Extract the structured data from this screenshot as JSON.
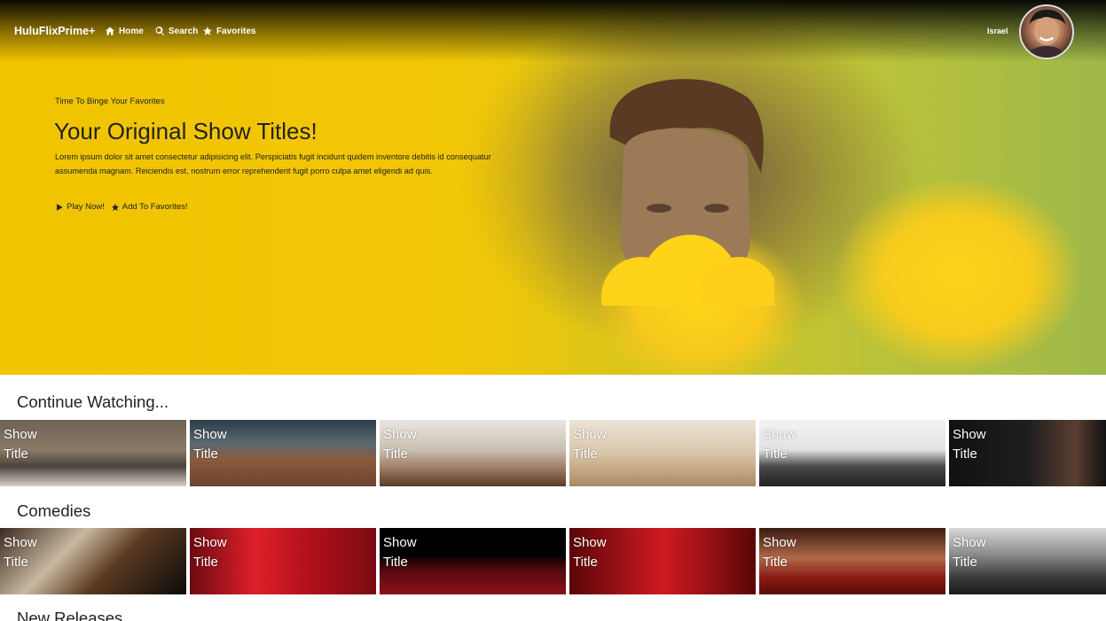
{
  "nav": {
    "brand": "HuluFlixPrime+",
    "items": [
      {
        "label": "Home",
        "icon": "home-icon"
      },
      {
        "label": "Search",
        "icon": "search-icon"
      },
      {
        "label": "Favorites",
        "icon": "star-icon"
      }
    ],
    "username": "Israel"
  },
  "hero": {
    "eyebrow": "Time To Binge Your Favorites",
    "title": "Your Original Show Titles!",
    "description": "Lorem ipsum dolor sit amet consectetur adipisicing elit. Perspiciatis fugit incidunt quidem inventore debitis id consequatur assumenda magnam. Reiciendis est, nostrum error reprehenderit fugit porro culpa amet eligendi ad quis.",
    "play_label": "Play Now!",
    "favorite_label": "Add To Favorites!"
  },
  "sections": [
    {
      "title": "Continue Watching...",
      "tiles": [
        {
          "line1": "Show",
          "line2": "Title",
          "bg": "linear-gradient(180deg,#6e6257 0%,#8a7a66 45%,#4a433c 70%,#d6d0c8 100%)"
        },
        {
          "line1": "Show",
          "line2": "Title",
          "bg": "linear-gradient(180deg,#2d3c46 0%,#5b6a70 35%,#8a5a3c 60%,#6b4430 100%)"
        },
        {
          "line1": "Show",
          "line2": "Title",
          "bg": "linear-gradient(180deg,#e9e6e0 0%,#c9bfb2 45%,#a3826a 70%,#5b3a2a 100%)"
        },
        {
          "line1": "Show",
          "line2": "Title",
          "bg": "linear-gradient(180deg,#ede4d6 0%,#d9c6a9 50%,#c4a884 75%,#a88a64 100%)"
        },
        {
          "line1": "Show",
          "line2": "Title",
          "bg": "linear-gradient(180deg,#f3f3f3 0%,#e2e2e2 45%,#4a4a4a 70%,#222 100%)"
        },
        {
          "line1": "Show",
          "line2": "Title",
          "bg": "linear-gradient(90deg,#111 0%,#1e1e1e 50%,#5a3e30 80%,#111 100%)"
        }
      ]
    },
    {
      "title": "Comedies",
      "tiles": [
        {
          "line1": "Show",
          "line2": "Title",
          "bg": "linear-gradient(135deg,#3a2a20 0%,#c8b8a0 35%,#5a3a20 60%,#0a0a0a 100%)"
        },
        {
          "line1": "Show",
          "line2": "Title",
          "bg": "linear-gradient(90deg,#6b0a10 0%,#e0202a 35%,#b0101a 65%,#7a0a12 100%)"
        },
        {
          "line1": "Show",
          "line2": "Title",
          "bg": "linear-gradient(180deg,#000 0%,#000 40%,#5a0a10 65%,#8a1018 100%)"
        },
        {
          "line1": "Show",
          "line2": "Title",
          "bg": "linear-gradient(90deg,#5a0608 0%,#d01a20 50%,#5a0608 100%)"
        },
        {
          "line1": "Show",
          "line2": "Title",
          "bg": "linear-gradient(180deg,#3a1a10 0%,#b06a4a 45%,#8a1a14 75%,#5a0c0a 100%)"
        },
        {
          "line1": "Show",
          "line2": "Title",
          "bg": "linear-gradient(180deg,#d8d8d8 0%,#8a8a8a 40%,#3a3a3a 75%,#1a1a1a 100%)"
        }
      ]
    },
    {
      "title": "New Releases",
      "tiles": []
    }
  ],
  "colors": {
    "hero_yellow": "#f5c400",
    "text_dark": "#222222",
    "nav_text": "#ffffff"
  }
}
